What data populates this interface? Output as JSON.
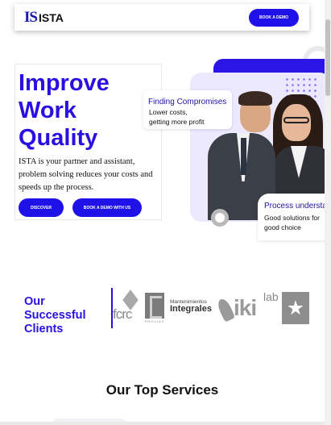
{
  "header": {
    "logo_mark": "IS",
    "logo_text": "ISTA",
    "demo_button": "BOOK A DEMO"
  },
  "hero": {
    "title_lines": [
      "Improve",
      "Work",
      "Quality"
    ],
    "description": "ISTA is your partner and assistant, problem solving reduces your costs and speeds up the process.",
    "discover_button": "DISCOVER",
    "book_button": "BOOK A DEMO WITH US"
  },
  "cards": {
    "finding": {
      "title": "Finding Compromises",
      "lines": [
        "Lower costs,",
        "getting more profit"
      ]
    },
    "process": {
      "title": "Process understan",
      "lines": [
        "Good solutions for",
        "good choice"
      ]
    }
  },
  "clients": {
    "title": "Our Successful Clients",
    "logos": {
      "fcrc": "fcrc",
      "proviax": "PROVIAX",
      "mant_line1": "Mantenimientos",
      "mant_line2": "Integrales",
      "iki": "iki",
      "lab": "lab"
    }
  },
  "services": {
    "title": "Our Top Services"
  },
  "colors": {
    "accent": "#1f12e8",
    "title_blue": "#2a10e0",
    "lilac": "#ece9ff"
  }
}
